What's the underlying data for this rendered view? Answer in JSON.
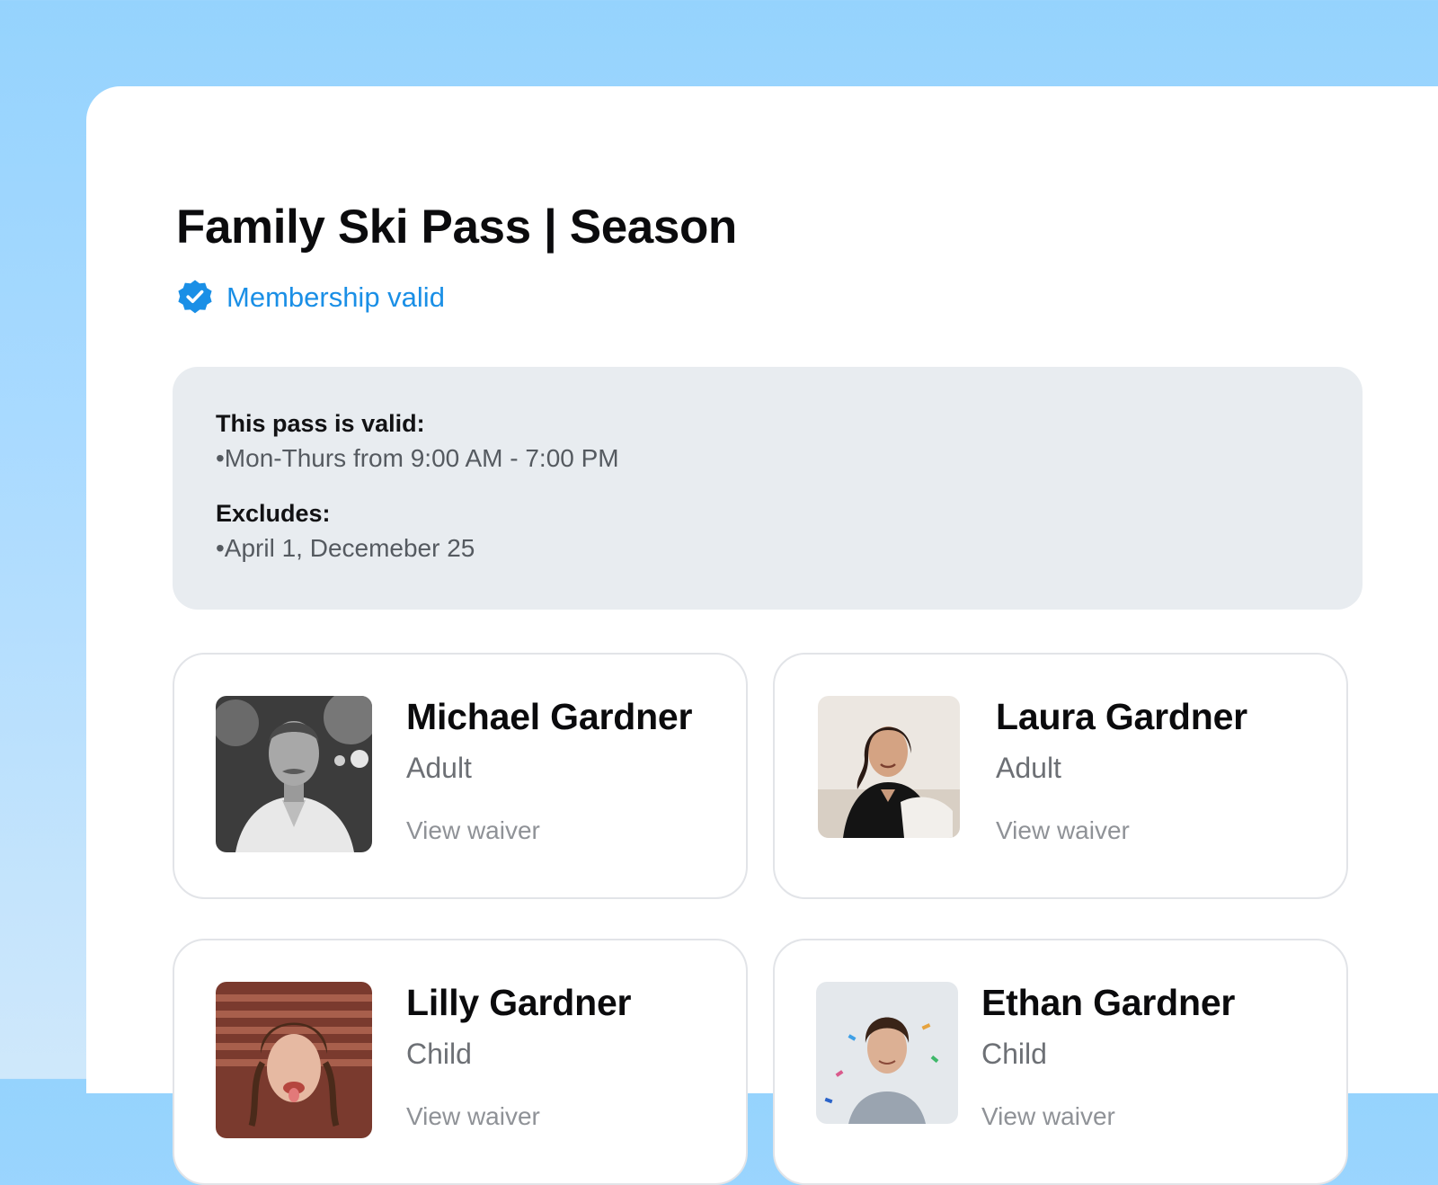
{
  "pass": {
    "title": "Family Ski Pass | Season",
    "status_text": "Membership valid",
    "accent_color": "#1a8fe6"
  },
  "validity": {
    "valid_heading": "This pass is valid:",
    "valid_line": "•Mon-Thurs from 9:00 AM - 7:00 PM",
    "excludes_heading": "Excludes:",
    "excludes_line": "•April 1, Decemeber 25"
  },
  "members": [
    {
      "name": "Michael Gardner",
      "role": "Adult",
      "link": "View waiver",
      "photo_icon": "man-portrait"
    },
    {
      "name": "Laura Gardner",
      "role": "Adult",
      "link": "View waiver",
      "photo_icon": "woman-portrait"
    },
    {
      "name": "Lilly Gardner",
      "role": "Child",
      "link": "View waiver",
      "photo_icon": "girl-portrait"
    },
    {
      "name": "Ethan Gardner",
      "role": "Child",
      "link": "View waiver",
      "photo_icon": "boy-portrait"
    }
  ]
}
